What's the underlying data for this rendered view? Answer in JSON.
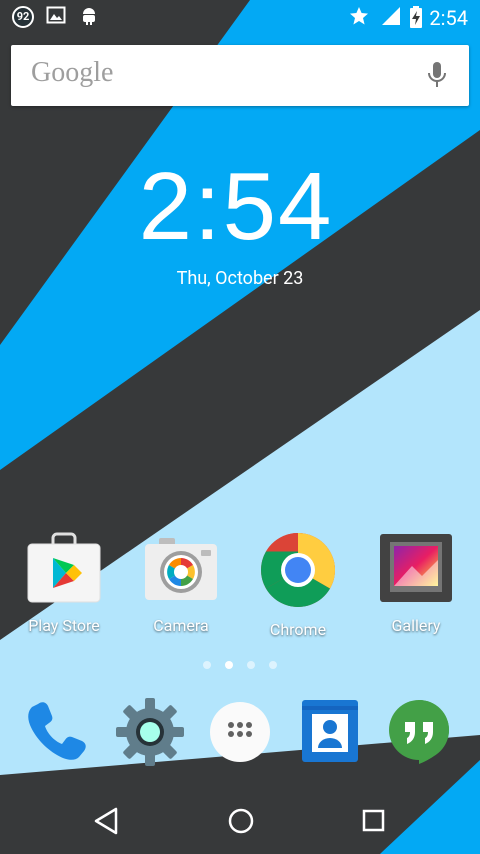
{
  "status_bar": {
    "notification_count": "92",
    "time": "2:54"
  },
  "search": {
    "logo_text": "Google"
  },
  "clock_widget": {
    "time": "2:54",
    "date": "Thu, October 23"
  },
  "apps": [
    {
      "label": "Play Store",
      "icon": "play-store-icon"
    },
    {
      "label": "Camera",
      "icon": "camera-icon"
    },
    {
      "label": "Chrome",
      "icon": "chrome-icon"
    },
    {
      "label": "Gallery",
      "icon": "gallery-icon"
    }
  ],
  "page_indicator": {
    "pages": 4,
    "current": 2
  },
  "dock": [
    {
      "icon": "phone-icon"
    },
    {
      "icon": "settings-icon"
    },
    {
      "icon": "app-drawer-icon"
    },
    {
      "icon": "contacts-icon"
    },
    {
      "icon": "hangouts-icon"
    }
  ],
  "nav_bar": {
    "buttons": [
      "back-icon",
      "home-icon",
      "recents-icon"
    ]
  },
  "colors": {
    "accent_blue": "#03a9f4",
    "light_blue": "#b3e5fc",
    "dark_gray": "#37393a"
  }
}
